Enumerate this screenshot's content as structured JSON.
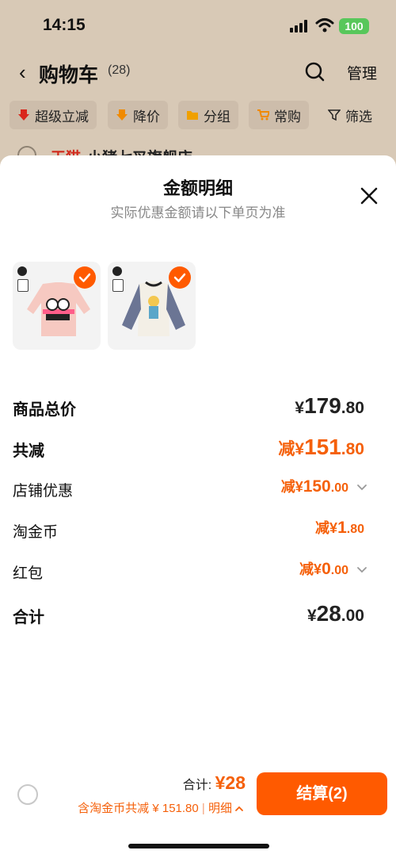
{
  "status_bar": {
    "time": "14:15",
    "battery": "100"
  },
  "nav": {
    "title": "购物车",
    "count": "(28)",
    "manage": "管理"
  },
  "filters": [
    {
      "label": "超级立减",
      "icon": "down-arrow-red-icon"
    },
    {
      "label": "降价",
      "icon": "down-arrow-orange-icon"
    },
    {
      "label": "分组",
      "icon": "folder-icon"
    },
    {
      "label": "常购",
      "icon": "cart-icon"
    },
    {
      "label": "筛选",
      "icon": "filter-icon"
    }
  ],
  "shop_peek": {
    "tmall": "天猫",
    "name": "小猪七叉旗舰店"
  },
  "sheet": {
    "title": "金额明细",
    "subtitle": "实际优惠金额请以下单页为准"
  },
  "rows": {
    "subtotal": {
      "label": "商品总价",
      "cur": "¥",
      "int": "179",
      "dec": ".80"
    },
    "total_discount": {
      "label": "共减",
      "pre": "减",
      "cur": "¥",
      "int": "151",
      "dec": ".80"
    },
    "shop_discount": {
      "label": "店铺优惠",
      "pre": "减",
      "cur": "¥",
      "int": "150",
      "dec": ".00"
    },
    "coins": {
      "label": "淘金币",
      "pre": "减",
      "cur": "¥",
      "int": "1",
      "dec": ".80"
    },
    "red_packet": {
      "label": "红包",
      "pre": "减",
      "cur": "¥",
      "int": "0",
      "dec": ".00"
    },
    "total": {
      "label": "合计",
      "cur": "¥",
      "int": "28",
      "dec": ".00"
    }
  },
  "bottom": {
    "total_label": "合计:",
    "total_value": "¥28",
    "savings": "含淘金币共减 ¥ 151.80",
    "detail": "明细",
    "pay_label": "结算(2)"
  },
  "colors": {
    "accent": "#ff5a00",
    "discount_text": "#f5600a"
  }
}
